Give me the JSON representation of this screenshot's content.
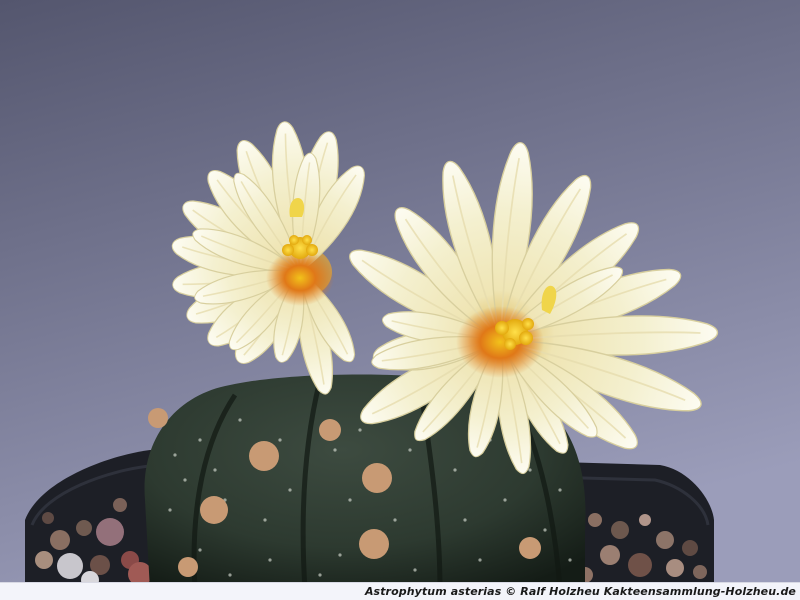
{
  "caption": "Astrophytum asterias  © Ralf Holzheu  Kakteensammlung-Holzheu.de",
  "colors": {
    "background_top": "#54566e",
    "background_bottom": "#9b9dba",
    "petal": "#f4f0cf",
    "petal_tip": "#fdfcf2",
    "stamen": "#f2c21a",
    "flower_throat": "#e07818",
    "cactus_body": "#2d3a30",
    "areole": "#c89a74",
    "pot": "#1d1f26",
    "gravel": "#8a6f62"
  },
  "subject": {
    "flower_count": 2,
    "icon": "cactus-flower"
  }
}
